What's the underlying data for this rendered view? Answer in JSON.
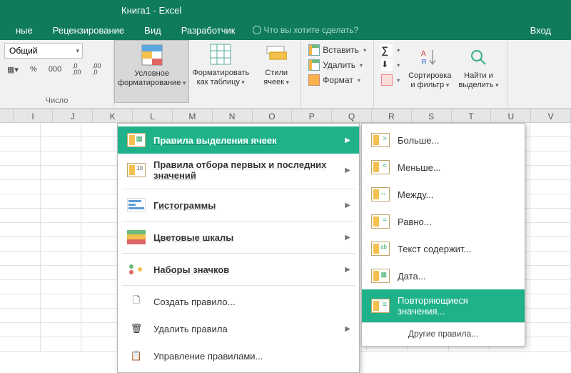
{
  "title": "Книга1 - Excel",
  "menubar": {
    "items": [
      "ные",
      "Рецензирование",
      "Вид",
      "Разработчик"
    ],
    "tellme": "Что вы хотите сделать?",
    "login": "Вход"
  },
  "ribbon": {
    "number_group": {
      "format_label": "Общий",
      "group_label": "Число",
      "btn_percent": "%",
      "btn_thousand": "000",
      "btn_dec_inc": ",00\n,0",
      "btn_dec_dec": ",0\n,00"
    },
    "styles": {
      "cond_fmt": "Условное<br>форматирование",
      "fmt_table": "Форматировать<br>как таблицу",
      "cell_styles": "Стили<br>ячеек"
    },
    "cells": {
      "insert": "Вставить",
      "delete": "Удалить",
      "format": "Формат"
    },
    "editing": {
      "sort": "Сортировка<br>и фильтр",
      "find": "Найти и<br>выделить"
    }
  },
  "columns": [
    "I",
    "J",
    "K",
    "L",
    "M",
    "N",
    "O",
    "P",
    "Q",
    "R",
    "S",
    "T",
    "U",
    "V"
  ],
  "dd1": {
    "items": [
      {
        "label": "Правила выделения ячеек",
        "hl": true,
        "sub": true
      },
      {
        "label": "Правила отбора первых и последних значений",
        "sub": true
      },
      {
        "label": "Гистограммы",
        "sub": true
      },
      {
        "label": "Цветовые шкалы",
        "sub": true
      },
      {
        "label": "Наборы значков",
        "sub": true
      }
    ],
    "extra": [
      {
        "label": "Создать правило..."
      },
      {
        "label": "Удалить правила"
      },
      {
        "label": "Управление правилами..."
      }
    ]
  },
  "dd2": {
    "items": [
      {
        "label": "Больше...",
        "sym": ">"
      },
      {
        "label": "Меньше...",
        "sym": "<"
      },
      {
        "label": "Между...",
        "sym": "—"
      },
      {
        "label": "Равно...",
        "sym": "="
      },
      {
        "label": "Текст содержит...",
        "sym": "ab"
      },
      {
        "label": "Дата...",
        "sym": "📅"
      },
      {
        "label": "Повторяющиеся значения...",
        "sym": "≡",
        "hl": true
      }
    ],
    "footer": "Другие правила..."
  }
}
